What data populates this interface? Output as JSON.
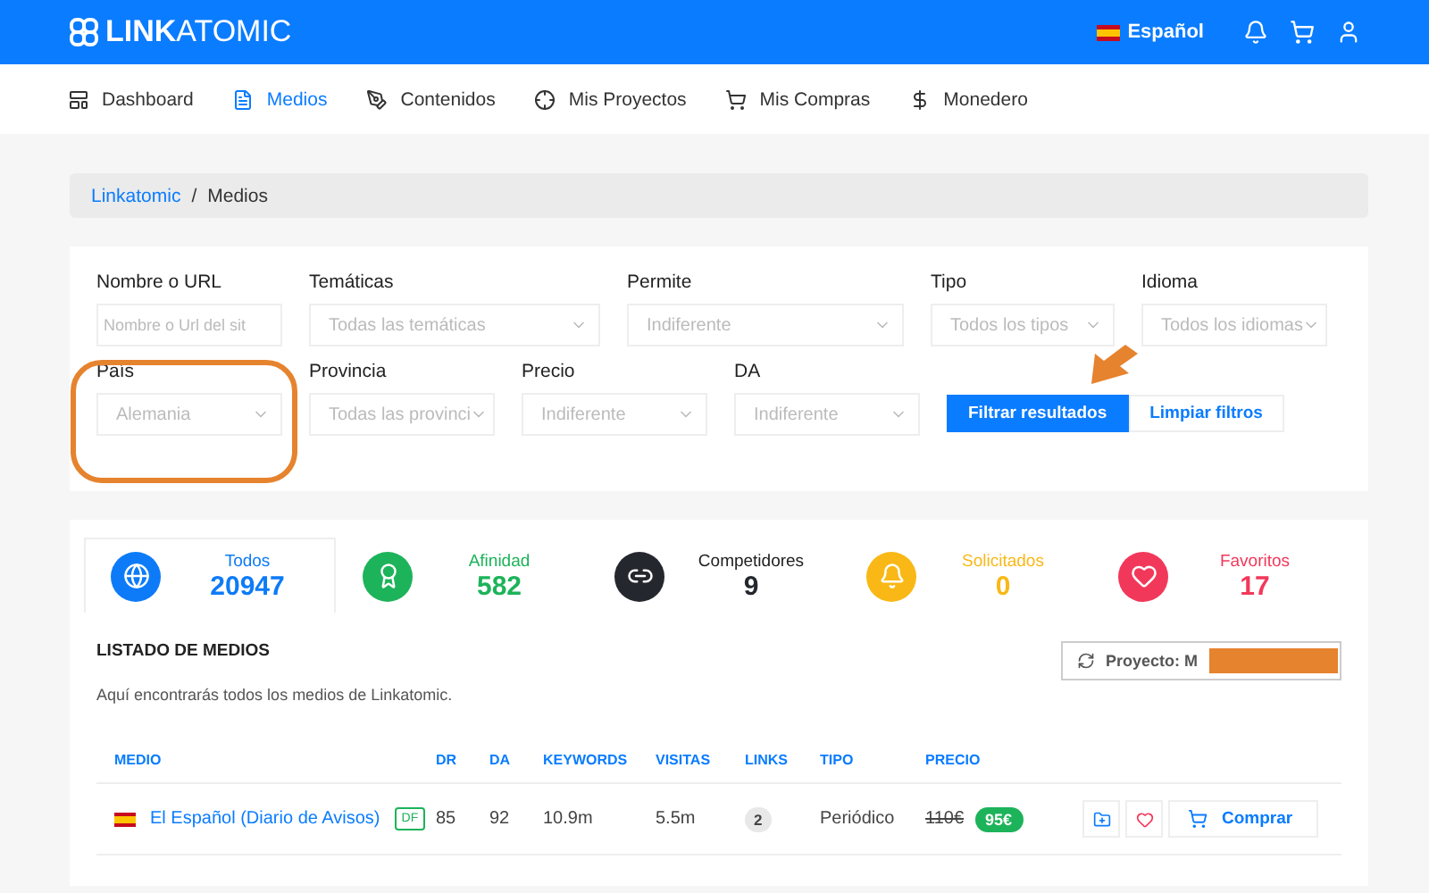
{
  "header": {
    "logo_bold": "LINK",
    "logo_light": "ATOMIC",
    "language": "Español"
  },
  "nav": [
    {
      "label": "Dashboard",
      "selected": false
    },
    {
      "label": "Medios",
      "selected": true
    },
    {
      "label": "Contenidos",
      "selected": false
    },
    {
      "label": "Mis Proyectos",
      "selected": false
    },
    {
      "label": "Mis Compras",
      "selected": false
    },
    {
      "label": "Monedero",
      "selected": false
    }
  ],
  "breadcrumb": [
    "Linkatomic",
    "/",
    "Medios"
  ],
  "filters": [
    {
      "label": "Nombre o URL",
      "placeholder": "Nombre o Url del sit",
      "kind": "input"
    },
    {
      "label": "Temáticas",
      "placeholder": "Todas las temáticas",
      "kind": "select"
    },
    {
      "label": "Permite",
      "placeholder": "Indiferente",
      "kind": "select"
    },
    {
      "label": "Tipo",
      "placeholder": "Todos los tipos",
      "kind": "select"
    },
    {
      "label": "Idioma",
      "placeholder": "Todos los idiomas",
      "kind": "select"
    },
    {
      "label": "País",
      "placeholder": "Alemania",
      "kind": "select"
    },
    {
      "label": "Provincia",
      "placeholder": "Todas las provinci",
      "kind": "select"
    },
    {
      "label": "Precio",
      "placeholder": "Indiferente",
      "kind": "select"
    },
    {
      "label": "DA",
      "placeholder": "Indiferente",
      "kind": "select"
    }
  ],
  "buttons": [
    "Filtrar resultados",
    "Limpiar filtros"
  ],
  "stats": [
    {
      "label": "Todos",
      "count": "20947",
      "color": "#0d7bf7",
      "selected": true
    },
    {
      "label": "Afinidad",
      "count": "582",
      "color": "#1db35a",
      "selected": false
    },
    {
      "label": "Competidores",
      "count": "9",
      "color": "#24272e",
      "selected": false
    },
    {
      "label": "Solicitados",
      "count": "0",
      "color": "#f9b816",
      "selected": false
    },
    {
      "label": "Favoritos",
      "count": "17",
      "color": "#f2385a",
      "selected": false
    }
  ],
  "listing": {
    "title": "LISTADO DE MEDIOS",
    "subtitle": "Aquí encontrarás todos los medios de Linkatomic.",
    "project": "Proyecto: M"
  },
  "table": {
    "columns": [
      "MEDIO",
      "DR",
      "DA",
      "KEYWORDS",
      "VISITAS",
      "LINKS",
      "TIPO",
      "PRECIO"
    ],
    "rows": [
      {
        "name": "El Español (Diario de Avisos)",
        "tag": "DF",
        "dr": "85",
        "da": "92",
        "keywords": "10.9m",
        "visits": "5.5m",
        "links": "2",
        "type": "Periódico",
        "old_price": "110€",
        "price": "95€",
        "action": "Comprar"
      }
    ]
  }
}
